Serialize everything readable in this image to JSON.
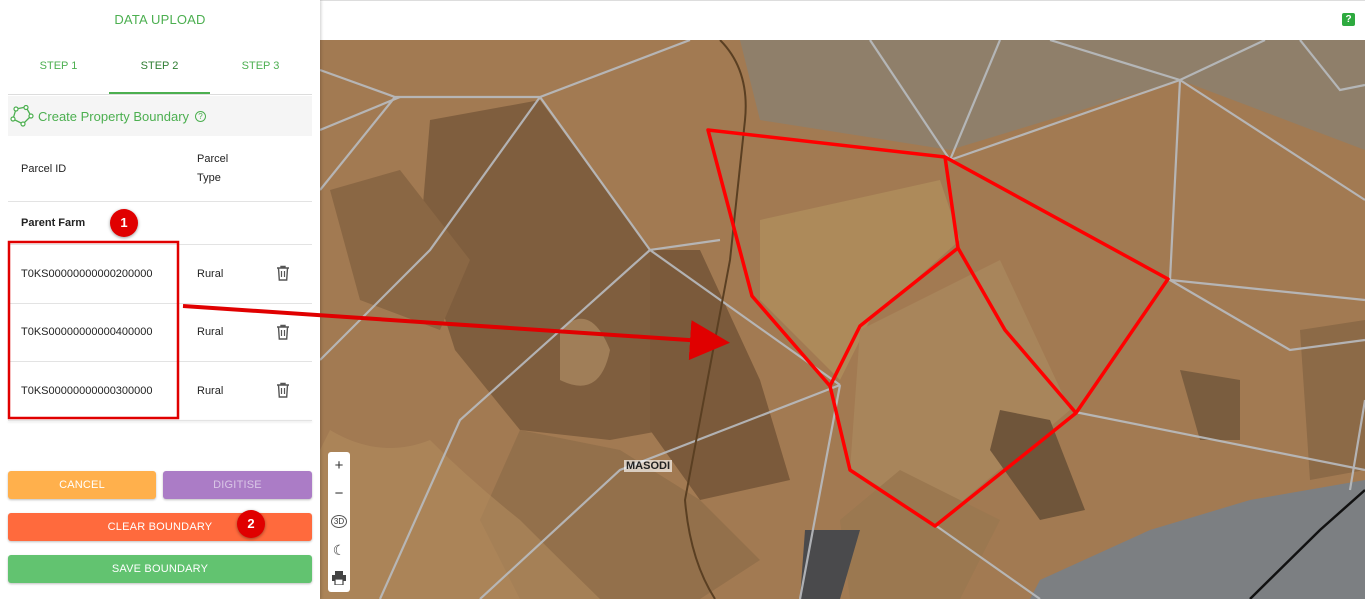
{
  "sidebar": {
    "title": "DATA UPLOAD",
    "tabs": [
      {
        "label": "STEP 1"
      },
      {
        "label": "STEP 2"
      },
      {
        "label": "STEP 3"
      }
    ],
    "section_title": "Create Property Boundary",
    "section_help": "?",
    "table": {
      "col_parcel_id": "Parcel ID",
      "col_parcel_type_1": "Parcel",
      "col_parcel_type_2": "Type",
      "group_label": "Parent Farm",
      "rows": [
        {
          "parcel_id": "T0KS00000000000200000",
          "type": "Rural"
        },
        {
          "parcel_id": "T0KS00000000000400000",
          "type": "Rural"
        },
        {
          "parcel_id": "T0KS00000000000300000",
          "type": "Rural"
        }
      ]
    },
    "buttons": {
      "cancel": "CANCEL",
      "digitise": "DIGITISE",
      "clear": "CLEAR BOUNDARY",
      "save": "SAVE BOUNDARY"
    },
    "colors": {
      "accent": "#4caf50",
      "cancel": "#ffb04c",
      "digitise": "#ab7cc6",
      "clear": "#ff6a3d",
      "save": "#62c370"
    }
  },
  "annotations": {
    "badge_1": "1",
    "badge_2": "2",
    "color": "#e00000"
  },
  "topbar": {
    "help": "?"
  },
  "map": {
    "place_label": "MASODI",
    "controls": {
      "zoom_in": "+",
      "zoom_out": "−",
      "view_3d": "3D"
    },
    "boundary_color": "#ff0000"
  }
}
